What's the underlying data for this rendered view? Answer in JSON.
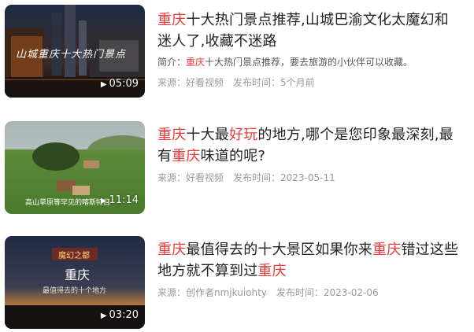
{
  "results": [
    {
      "title_parts": [
        {
          "text": "重庆",
          "hl": true
        },
        {
          "text": "十大热门景点推荐,山城巴渝文化太魔幻和迷人了,收藏不迷路",
          "hl": false
        }
      ],
      "summary_label": "简介：",
      "summary_parts": [
        {
          "text": "重庆",
          "hl": true
        },
        {
          "text": "十大热门景点推荐，要去旅游的小伙伴可以收藏。",
          "hl": false
        }
      ],
      "source": "来源：好看视频",
      "date": "发布时间：5个月前",
      "duration": "05:09",
      "thumb_caption": "山城重庆十大热门景点",
      "thumb_icon": "night-skyline-image"
    },
    {
      "title_parts": [
        {
          "text": "重庆",
          "hl": true
        },
        {
          "text": "十大最",
          "hl": false
        },
        {
          "text": "好玩",
          "hl": true
        },
        {
          "text": "的地方,哪个是您印象最深刻,最有",
          "hl": false
        },
        {
          "text": "重庆",
          "hl": true
        },
        {
          "text": "味道的呢?",
          "hl": false
        }
      ],
      "source": "来源：好看视频",
      "date": "发布时间：2023-05-11",
      "duration": "11:14",
      "thumb_caption": "高山草原等罕见的喀斯特目",
      "thumb_icon": "grassland-cattle-image"
    },
    {
      "title_parts": [
        {
          "text": "重庆",
          "hl": true
        },
        {
          "text": "最值得去的十大景区如果你来",
          "hl": false
        },
        {
          "text": "重庆",
          "hl": true
        },
        {
          "text": "错过这些地方就不算到过",
          "hl": false
        },
        {
          "text": "重庆",
          "hl": true
        }
      ],
      "source": "来源：创作者nmjkuiohty",
      "date": "发布时间：2023-02-06",
      "duration": "03:20",
      "thumb_badge": "魔幻之都",
      "thumb_title": "重庆",
      "thumb_subtitle": "最值得去的十个地方",
      "thumb_icon": "sunset-horizon-image"
    }
  ],
  "colors": {
    "highlight": "#e63b3b",
    "title": "#222222",
    "meta": "#9a9a9a"
  }
}
